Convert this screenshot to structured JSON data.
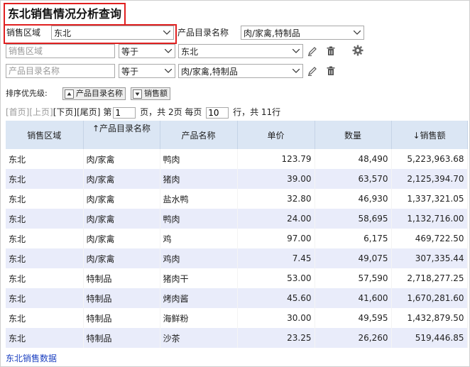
{
  "title": "东北销售情况分析查询",
  "filters": {
    "region_label": "销售区域",
    "region_value": "东北",
    "catalog_label": "产品目录名称",
    "catalog_value": "肉/家禽,特制品",
    "rows": [
      {
        "field_placeholder": "销售区域",
        "operator": "等于",
        "value": "东北"
      },
      {
        "field_placeholder": "产品目录名称",
        "operator": "等于",
        "value": "肉/家禽,特制品"
      }
    ]
  },
  "sort": {
    "label": "排序优先级:",
    "items": [
      "产品目录名称",
      "销售额"
    ]
  },
  "pager": {
    "first": "[首页]",
    "prev": "[上页]",
    "next": "[下页]",
    "last": "[尾页]",
    "page_prefix": "第",
    "current_page": "1",
    "total_text": "页，共 2页 每页",
    "page_size": "10",
    "rows_text": "行，共 11行"
  },
  "table": {
    "columns": [
      "销售区域",
      "↑产品目录名称",
      "产品名称",
      "单价",
      "数量",
      "↓销售额"
    ],
    "rows": [
      [
        "东北",
        "肉/家禽",
        "鸭肉",
        "123.79",
        "48,490",
        "5,223,963.68"
      ],
      [
        "东北",
        "肉/家禽",
        "猪肉",
        "39.00",
        "63,570",
        "2,125,394.70"
      ],
      [
        "东北",
        "肉/家禽",
        "盐水鸭",
        "32.80",
        "46,930",
        "1,337,321.05"
      ],
      [
        "东北",
        "肉/家禽",
        "鸭肉",
        "24.00",
        "58,695",
        "1,132,716.00"
      ],
      [
        "东北",
        "肉/家禽",
        "鸡",
        "97.00",
        "6,175",
        "469,722.50"
      ],
      [
        "东北",
        "肉/家禽",
        "鸡肉",
        "7.45",
        "49,075",
        "307,335.44"
      ],
      [
        "东北",
        "特制品",
        "猪肉干",
        "53.00",
        "57,590",
        "2,718,277.25"
      ],
      [
        "东北",
        "特制品",
        "烤肉酱",
        "45.60",
        "41,600",
        "1,670,281.60"
      ],
      [
        "东北",
        "特制品",
        "海鲜粉",
        "30.00",
        "49,595",
        "1,432,879.50"
      ],
      [
        "东北",
        "特制品",
        "沙茶",
        "23.25",
        "26,260",
        "519,446.85"
      ]
    ]
  },
  "footer_link": "东北销售数据",
  "colors": {
    "highlight": "#e02020",
    "header_bg": "#dbe6f4",
    "row_alt": "#e9ecfa",
    "link": "#1a3fc0"
  }
}
